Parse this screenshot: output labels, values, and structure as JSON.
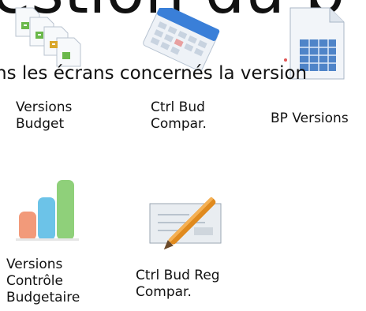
{
  "background_heading": {
    "title": "estion du b",
    "subtitle": "ns les écrans concernés la version"
  },
  "tiles": [
    {
      "label": "Versions\nBudget",
      "icon": "stacked-documents-icon"
    },
    {
      "label": "Ctrl Bud\nCompar.",
      "icon": "calendar-icon"
    },
    {
      "label": "BP Versions",
      "icon": "spreadsheet-document-icon"
    },
    {
      "label": "Versions\nContrôle\nBudgetaire",
      "icon": "bar-chart-icon"
    },
    {
      "label": "Ctrl Bud Reg\nCompar.",
      "icon": "check-and-pen-icon"
    }
  ],
  "colors": {
    "calendar_blue": "#3a7fd8",
    "bar_orange": "#f29a7a",
    "bar_blue": "#6cc3e8",
    "bar_green": "#8fd07a"
  }
}
